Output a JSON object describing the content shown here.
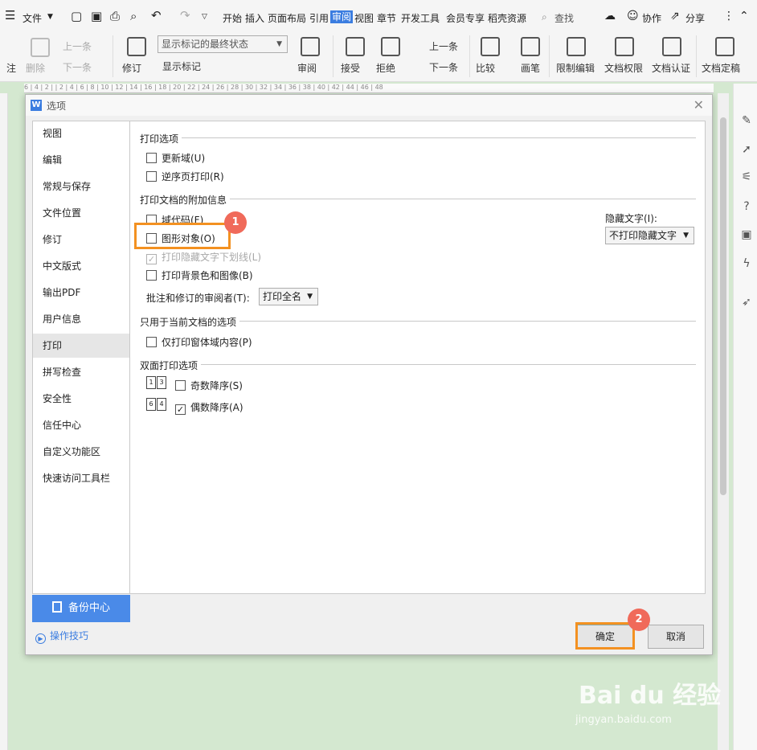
{
  "menubar": {
    "file_label": "文件",
    "tabs": [
      "开始",
      "插入",
      "页面布局",
      "引用",
      "审阅",
      "视图",
      "章节",
      "开发工具",
      "会员专享",
      "稻壳资源"
    ],
    "active_tab": "审阅",
    "search": "查找",
    "collab": "协作",
    "share": "分享"
  },
  "ribbon": {
    "zhu": "注",
    "delete": "删除",
    "prev_comment": "上一条",
    "next_comment": "下一条",
    "revise": "修订",
    "display_state": "显示标记的最终状态",
    "show_markup": "显示标记",
    "review": "审阅",
    "accept": "接受",
    "reject": "拒绝",
    "prev_change": "上一条",
    "next_change": "下一条",
    "compare": "比较",
    "pen": "画笔",
    "restrict_edit": "限制编辑",
    "doc_rights": "文档权限",
    "doc_cert": "文档认证",
    "doc_finalize": "文档定稿"
  },
  "ruler_text": "6 | 4 | 2 | | 2 | 4 | 6 | 8 | 10 | 12 | 14 | 16 | 18 | 20 | 22 | 24 | 26 | 28 | 30 | 32 | 34 | 36 | 38 | 40 | 42 | 44 | 46 | 48",
  "dialog": {
    "title": "选项",
    "nav": [
      "视图",
      "编辑",
      "常规与保存",
      "文件位置",
      "修订",
      "中文版式",
      "输出PDF",
      "用户信息",
      "打印",
      "拼写检查",
      "安全性",
      "信任中心",
      "自定义功能区",
      "快速访问工具栏"
    ],
    "selected_nav": "打印",
    "backup": "备份中心",
    "tips": "操作技巧",
    "sec_print_options": "打印选项",
    "update_fields": "更新域(U)",
    "reverse_print": "逆序页打印(R)",
    "sec_extra_info": "打印文档的附加信息",
    "field_codes": "域代码(F)",
    "graphic_objects": "图形对象(O)",
    "hidden_text_underline": "打印隐藏文字下划线(L)",
    "print_bg": "打印背景色和图像(B)",
    "reviewer_label": "批注和修订的审阅者(T):",
    "reviewer_value": "打印全名",
    "hidden_text_label": "隐藏文字(I):",
    "hidden_text_value": "不打印隐藏文字",
    "sec_current_doc": "只用于当前文档的选项",
    "form_data_only": "仅打印窗体域内容(P)",
    "sec_duplex": "双面打印选项",
    "odd_reverse": "奇数降序(S)",
    "even_reverse": "偶数降序(A)",
    "ok": "确定",
    "cancel": "取消"
  },
  "annotations": {
    "badge1": "1",
    "badge2": "2",
    "highlight_color": "#f39121",
    "badge_color": "#f06a5a"
  },
  "watermark": {
    "brand": "Bai du 经验",
    "url": "jingyan.baidu.com"
  }
}
